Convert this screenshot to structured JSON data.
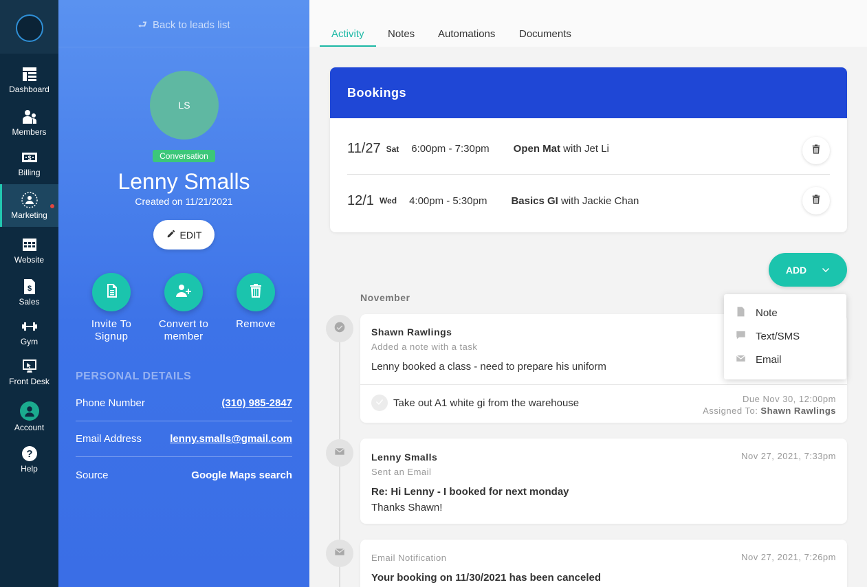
{
  "nav": {
    "items": [
      {
        "label": "Dashboard",
        "icon": "dashboard-icon"
      },
      {
        "label": "Members",
        "icon": "members-icon"
      },
      {
        "label": "Billing",
        "icon": "billing-icon"
      },
      {
        "label": "Marketing",
        "icon": "marketing-icon",
        "active": true
      },
      {
        "label": "Website",
        "icon": "website-icon"
      },
      {
        "label": "Sales",
        "icon": "sales-icon"
      },
      {
        "label": "Gym",
        "icon": "dumbbell-icon"
      },
      {
        "label": "Front Desk",
        "icon": "front-desk-icon"
      },
      {
        "label": "Account",
        "icon": "account-icon"
      },
      {
        "label": "Help",
        "icon": "help-icon"
      }
    ]
  },
  "lead": {
    "back_label": "Back to leads list",
    "initials": "LS",
    "status": "Conversation",
    "name": "Lenny Smalls",
    "created": "Created on 11/21/2021",
    "edit_label": "EDIT",
    "actions": [
      {
        "line1": "Invite To",
        "line2": "Signup",
        "icon": "document-icon"
      },
      {
        "line1": "Convert to",
        "line2": "member",
        "icon": "add-user-icon"
      },
      {
        "line1": "Remove",
        "line2": "",
        "icon": "trash-icon"
      }
    ],
    "details_title": "PERSONAL DETAILS",
    "details": [
      {
        "label": "Phone Number",
        "value": "(310) 985-2847"
      },
      {
        "label": "Email Address",
        "value": "lenny.smalls@gmail.com"
      },
      {
        "label": "Source",
        "value": "Google Maps search"
      }
    ]
  },
  "tabs": [
    "Activity",
    "Notes",
    "Automations",
    "Documents"
  ],
  "bookings": {
    "title": "Bookings",
    "rows": [
      {
        "date": "11/27",
        "day": "Sat",
        "time": "6:00pm - 7:30pm",
        "class": "Open Mat",
        "with": " with Jet Li"
      },
      {
        "date": "12/1",
        "day": "Wed",
        "time": "4:00pm - 5:30pm",
        "class": "Basics GI",
        "with": " with Jackie Chan"
      }
    ]
  },
  "add": {
    "label": "ADD",
    "menu": [
      {
        "label": "Note",
        "icon": "note-icon"
      },
      {
        "label": "Text/SMS",
        "icon": "chat-icon"
      },
      {
        "label": "Email",
        "icon": "email-icon"
      }
    ]
  },
  "timeline": {
    "month": "November",
    "items": [
      {
        "author": "Shawn Rawlings",
        "sub": "Added a note with a task",
        "body": "Lenny booked a class - need to prepare his uniform",
        "task": {
          "text": "Take out A1 white gi from the warehouse",
          "due": "Due Nov 30, 12:00pm",
          "assigned_prefix": "Assigned To: ",
          "assigned_to": "Shawn Rawlings"
        }
      },
      {
        "author": "Lenny Smalls",
        "sub": "Sent an Email",
        "time": "Nov 27, 2021, 7:33pm",
        "subject": "Re: Hi Lenny - I booked for next monday",
        "body": "Thanks Shawn!"
      },
      {
        "sub": "Email Notification",
        "time": "Nov 27, 2021, 7:26pm",
        "subject": "Your booking on 11/30/2021 has been canceled"
      }
    ]
  }
}
